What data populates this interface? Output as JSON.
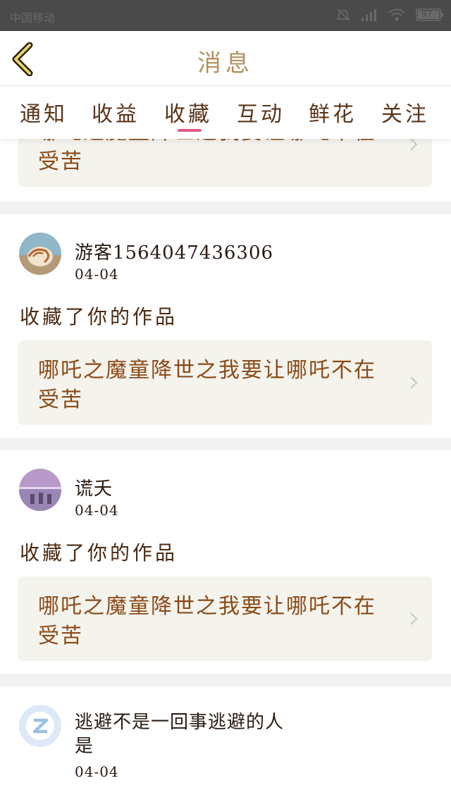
{
  "status_bar": {
    "left_text": "中国移动",
    "battery": "97"
  },
  "header": {
    "title": "消息"
  },
  "tabs": [
    {
      "label": "通知"
    },
    {
      "label": "收益"
    },
    {
      "label": "收藏"
    },
    {
      "label": "互动"
    },
    {
      "label": "鲜花"
    },
    {
      "label": "关注"
    }
  ],
  "active_tab": "收藏",
  "partial_card": {
    "work_title": "哪吒之魔童降世之我要让哪吒不在受苦"
  },
  "messages": [
    {
      "username": "游客1564047436306",
      "date": "04-04",
      "action": "收藏了你的作品",
      "work_title": "哪吒之魔童降世之我要让哪吒不在受苦"
    },
    {
      "username": "谎夭",
      "date": "04-04",
      "action": "收藏了你的作品",
      "work_title": "哪吒之魔童降世之我要让哪吒不在受苦"
    },
    {
      "username": "逃避不是一回事逃避的人是",
      "date": "04-04"
    }
  ],
  "colors": {
    "accent_underline": "#e0598b",
    "card_bg": "#f4f3ec",
    "status_bar_bg": "#4a4a4a"
  }
}
